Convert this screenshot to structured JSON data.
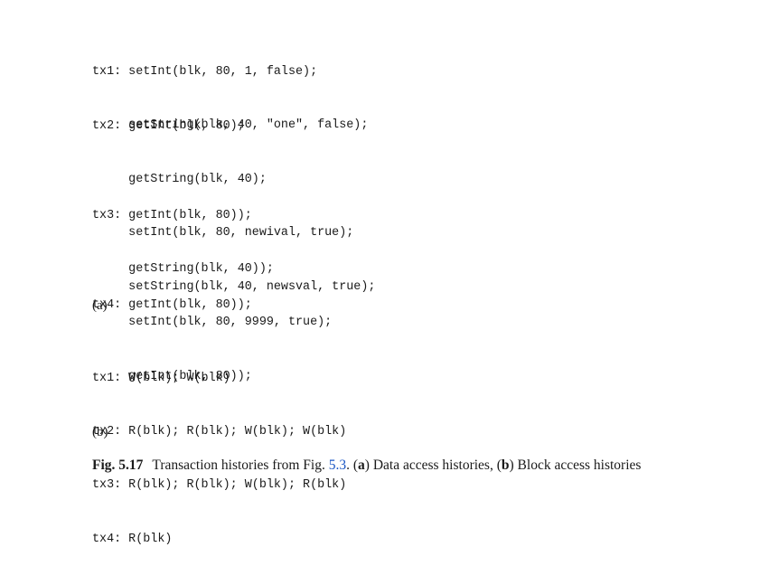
{
  "figure": {
    "part_a": {
      "tx1": [
        "tx1: setInt(blk, 80, 1, false);",
        "     setString(blk, 40, \"one\", false);"
      ],
      "tx2": [
        "tx2: getInt(blk, 80);",
        "     getString(blk, 40);",
        "     setInt(blk, 80, newival, true);",
        "     setString(blk, 40, newsval, true);"
      ],
      "tx3": [
        "tx3: getInt(blk, 80));",
        "     getString(blk, 40));",
        "     setInt(blk, 80, 9999, true);",
        "     getInt(blk, 80));"
      ],
      "tx4": [
        "tx4: getInt(blk, 80));"
      ],
      "label": "(a)"
    },
    "part_b": {
      "lines": [
        "tx1: W(blk); W(blk)",
        "tx2: R(blk); R(blk); W(blk); W(blk)",
        "tx3: R(blk); R(blk); W(blk); R(blk)",
        "tx4: R(blk)"
      ],
      "label": "(b)"
    },
    "caption": {
      "number": "Fig. 5.17",
      "text_before_ref": "Transaction histories from Fig.",
      "ref": "5.3",
      "text_after_ref": ".",
      "part_a_marker": "a",
      "part_a_text": "Data access histories,",
      "part_b_marker": "b",
      "part_b_text": "Block access histories"
    }
  }
}
